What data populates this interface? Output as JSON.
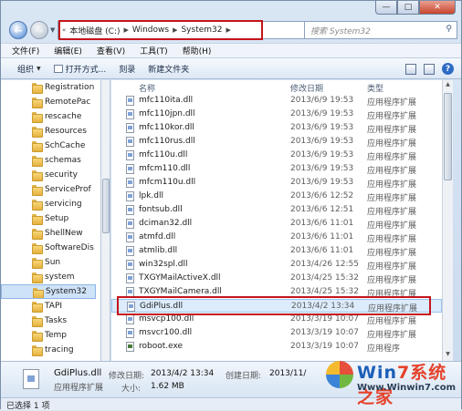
{
  "window": {
    "caption_buttons": [
      "—",
      "□",
      "✕"
    ]
  },
  "address": {
    "back_symbol": "«",
    "crumbs": [
      "本地磁盘 (C:)",
      "Windows",
      "System32"
    ],
    "refresh_symbol": "↻",
    "search_placeholder": "搜索 System32",
    "highlight_color": "#c3141b"
  },
  "menu": [
    "文件(F)",
    "编辑(E)",
    "查看(V)",
    "工具(T)",
    "帮助(H)"
  ],
  "toolbar": {
    "organize": "组织",
    "open_with": "打开方式...",
    "burn": "刻录",
    "new_folder": "新建文件夹"
  },
  "nav_items": [
    "Registration",
    "RemotePac",
    "rescache",
    "Resources",
    "SchCache",
    "schemas",
    "security",
    "ServiceProf",
    "servicing",
    "Setup",
    "ShellNew",
    "SoftwareDis",
    "Sun",
    "system",
    "System32",
    "TAPI",
    "Tasks",
    "Temp",
    "tracing"
  ],
  "columns": {
    "name": "名称",
    "date": "修改日期",
    "type": "类型"
  },
  "files": [
    {
      "name": "mfc110ita.dll",
      "date": "2013/6/9 19:53",
      "type": "应用程序扩展"
    },
    {
      "name": "mfc110jpn.dll",
      "date": "2013/6/9 19:53",
      "type": "应用程序扩展"
    },
    {
      "name": "mfc110kor.dll",
      "date": "2013/6/9 19:53",
      "type": "应用程序扩展"
    },
    {
      "name": "mfc110rus.dll",
      "date": "2013/6/9 19:53",
      "type": "应用程序扩展"
    },
    {
      "name": "mfc110u.dll",
      "date": "2013/6/9 19:53",
      "type": "应用程序扩展"
    },
    {
      "name": "mfcm110.dll",
      "date": "2013/6/9 19:53",
      "type": "应用程序扩展"
    },
    {
      "name": "mfcm110u.dll",
      "date": "2013/6/9 19:53",
      "type": "应用程序扩展"
    },
    {
      "name": "lpk.dll",
      "date": "2013/6/6 12:52",
      "type": "应用程序扩展"
    },
    {
      "name": "fontsub.dll",
      "date": "2013/6/6 12:51",
      "type": "应用程序扩展"
    },
    {
      "name": "dciman32.dll",
      "date": "2013/6/6 11:01",
      "type": "应用程序扩展"
    },
    {
      "name": "atmfd.dll",
      "date": "2013/6/6 11:01",
      "type": "应用程序扩展"
    },
    {
      "name": "atmlib.dll",
      "date": "2013/6/6 11:01",
      "type": "应用程序扩展"
    },
    {
      "name": "win32spl.dll",
      "date": "2013/4/26 12:55",
      "type": "应用程序扩展"
    },
    {
      "name": "TXGYMailActiveX.dll",
      "date": "2013/4/25 15:32",
      "type": "应用程序扩展"
    },
    {
      "name": "TXGYMailCamera.dll",
      "date": "2013/4/25 15:32",
      "type": "应用程序扩展"
    },
    {
      "name": "GdiPlus.dll",
      "date": "2013/4/2 13:34",
      "type": "应用程序扩展",
      "selected": true
    },
    {
      "name": "msvcp100.dll",
      "date": "2013/3/19 10:07",
      "type": "应用程序扩展"
    },
    {
      "name": "msvcr100.dll",
      "date": "2013/3/19 10:07",
      "type": "应用程序扩展"
    },
    {
      "name": "roboot.exe",
      "date": "2013/3/19 10:07",
      "type": "应用程序"
    }
  ],
  "details": {
    "name": "GdiPlus.dll",
    "type": "应用程序扩展",
    "modified_label": "修改日期:",
    "modified_value": "2013/4/2 13:34",
    "size_label": "大小:",
    "size_value": "1.62 MB",
    "created_label": "创建日期:",
    "created_value": "2013/11/"
  },
  "status": "已选择 1 项",
  "watermark": {
    "title_prefix": "Win",
    "title_suffix": "7系统之家",
    "url": "Www.Winwin7.com"
  }
}
